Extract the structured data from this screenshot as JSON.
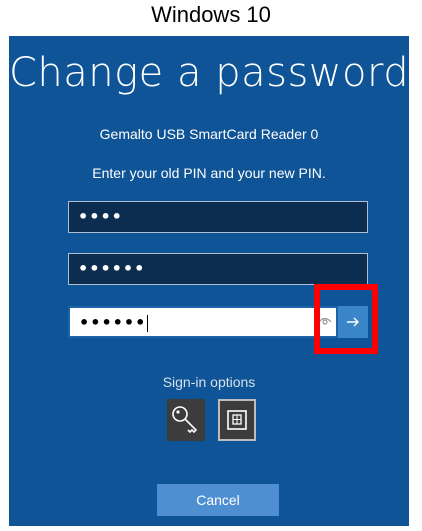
{
  "caption": "Windows 10",
  "dialog": {
    "title": "Change a password",
    "device_name": "Gemalto USB SmartCard Reader 0",
    "prompt": "Enter your old PIN and your new PIN."
  },
  "fields": {
    "old_pin_masked": "••••",
    "new_pin_masked": "••••••",
    "confirm_pin_masked": "••••••"
  },
  "signin": {
    "label": "Sign-in options",
    "options": [
      "key-icon",
      "smartcard-icon"
    ]
  },
  "buttons": {
    "submit_icon": "arrow-right-icon",
    "cancel": "Cancel"
  },
  "colors": {
    "background": "#0f5496",
    "highlight": "#ff0000"
  }
}
